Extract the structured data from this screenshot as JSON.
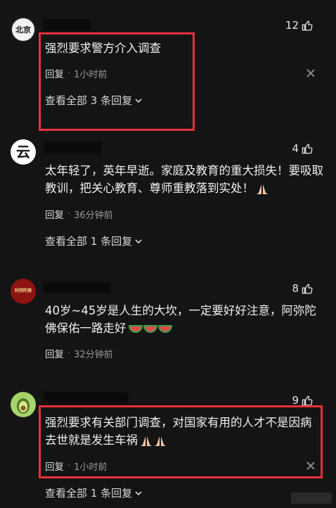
{
  "comments": [
    {
      "likes": "12",
      "text": "强烈要求警方介入调查",
      "reply_label": "回复",
      "time": "1小时前",
      "view_replies": "查看全部 3 条回复",
      "avatar_text": "北京"
    },
    {
      "likes": "4",
      "text": "太年轻了，英年早逝。家庭及教育的重大损失！要吸取教训，把关心教育、尊师重教落到实处！",
      "reply_label": "回复",
      "time": "36分钟前",
      "view_replies": "查看全部 1 条回复",
      "avatar_text": "云"
    },
    {
      "likes": "8",
      "text": "40岁~45岁是人生的大坎，一定要好好注意，阿弥陀佛保佑一路走好",
      "reply_label": "回复",
      "time": "32分钟前",
      "avatar_text": "阿弥陀佛"
    },
    {
      "likes": "9",
      "text": "强烈要求有关部门调查，对国家有用的人才不是因病去世就是发生车祸",
      "reply_label": "回复",
      "time": "1小时前",
      "view_replies": "查看全部 1 条回复"
    }
  ],
  "colors": {
    "highlight_box": "#e8303a",
    "background": "#141414"
  },
  "icons": [
    "thumbs-up-icon",
    "close-icon",
    "chevron-down-icon",
    "praying-hands-icon",
    "watermelon-icon"
  ]
}
